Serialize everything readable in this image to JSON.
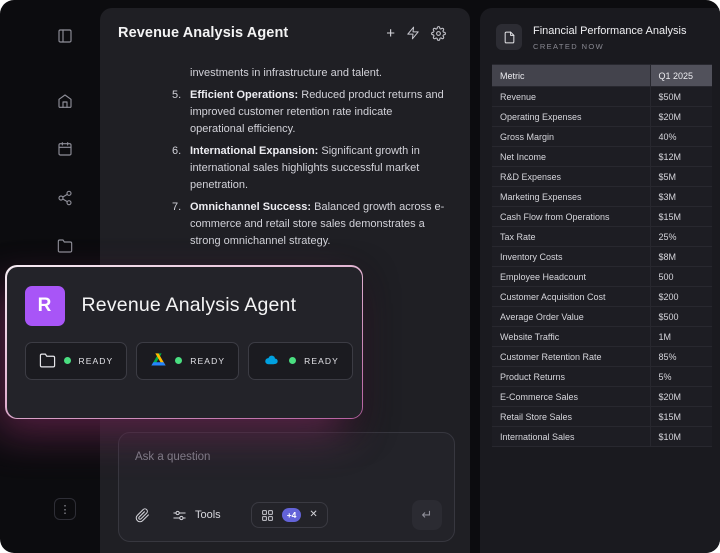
{
  "icons": {
    "plus": "+",
    "close": "✕",
    "kebab": "⋮",
    "return": "↵"
  },
  "sidebar": {
    "items": [
      {
        "name": "panel-toggle"
      },
      {
        "name": "home"
      },
      {
        "name": "calendar"
      },
      {
        "name": "share-nodes"
      },
      {
        "name": "folder"
      },
      {
        "name": "more-options"
      }
    ]
  },
  "chat": {
    "title": "Revenue Analysis Agent",
    "transcript": {
      "continuation": "investments in infrastructure and talent.",
      "items": [
        {
          "num": "5.",
          "heading": "Efficient Operations:",
          "text": "Reduced product returns and improved customer retention rate indicate operational efficiency."
        },
        {
          "num": "6.",
          "heading": "International Expansion:",
          "text": "Significant growth in international sales highlights successful market penetration."
        },
        {
          "num": "7.",
          "heading": "Omnichannel Success:",
          "text": "Balanced growth across e-commerce and retail store sales demonstrates a strong omnichannel strategy."
        }
      ]
    },
    "composer": {
      "placeholder": "Ask a question",
      "tools_label": "Tools",
      "selected_count": "+4"
    }
  },
  "agent_card": {
    "avatar_letter": "R",
    "avatar_color": "#a855f7",
    "title": "Revenue Analysis Agent",
    "status_color": "#4ade80",
    "connectors": [
      {
        "icon": "folder",
        "status": "READY"
      },
      {
        "icon": "google-drive",
        "status": "READY"
      },
      {
        "icon": "salesforce-cloud",
        "status": "READY"
      }
    ]
  },
  "report": {
    "title": "Financial Performance Analysis",
    "subtitle": "CREATED NOW",
    "table": {
      "columns": [
        "Metric",
        "Q1 2025"
      ],
      "rows": [
        [
          "Revenue",
          "$50M"
        ],
        [
          "Operating Expenses",
          "$20M"
        ],
        [
          "Gross Margin",
          "40%"
        ],
        [
          "Net Income",
          "$12M"
        ],
        [
          "R&D Expenses",
          "$5M"
        ],
        [
          "Marketing Expenses",
          "$3M"
        ],
        [
          "Cash Flow from Operations",
          "$15M"
        ],
        [
          "Tax Rate",
          "25%"
        ],
        [
          "Inventory Costs",
          "$8M"
        ],
        [
          "Employee Headcount",
          "500"
        ],
        [
          "Customer Acquisition Cost",
          "$200"
        ],
        [
          "Average Order Value",
          "$500"
        ],
        [
          "Website Traffic",
          "1M"
        ],
        [
          "Customer Retention Rate",
          "85%"
        ],
        [
          "Product Returns",
          "5%"
        ],
        [
          "E-Commerce Sales",
          "$20M"
        ],
        [
          "Retail Store Sales",
          "$15M"
        ],
        [
          "International Sales",
          "$10M"
        ]
      ]
    }
  }
}
